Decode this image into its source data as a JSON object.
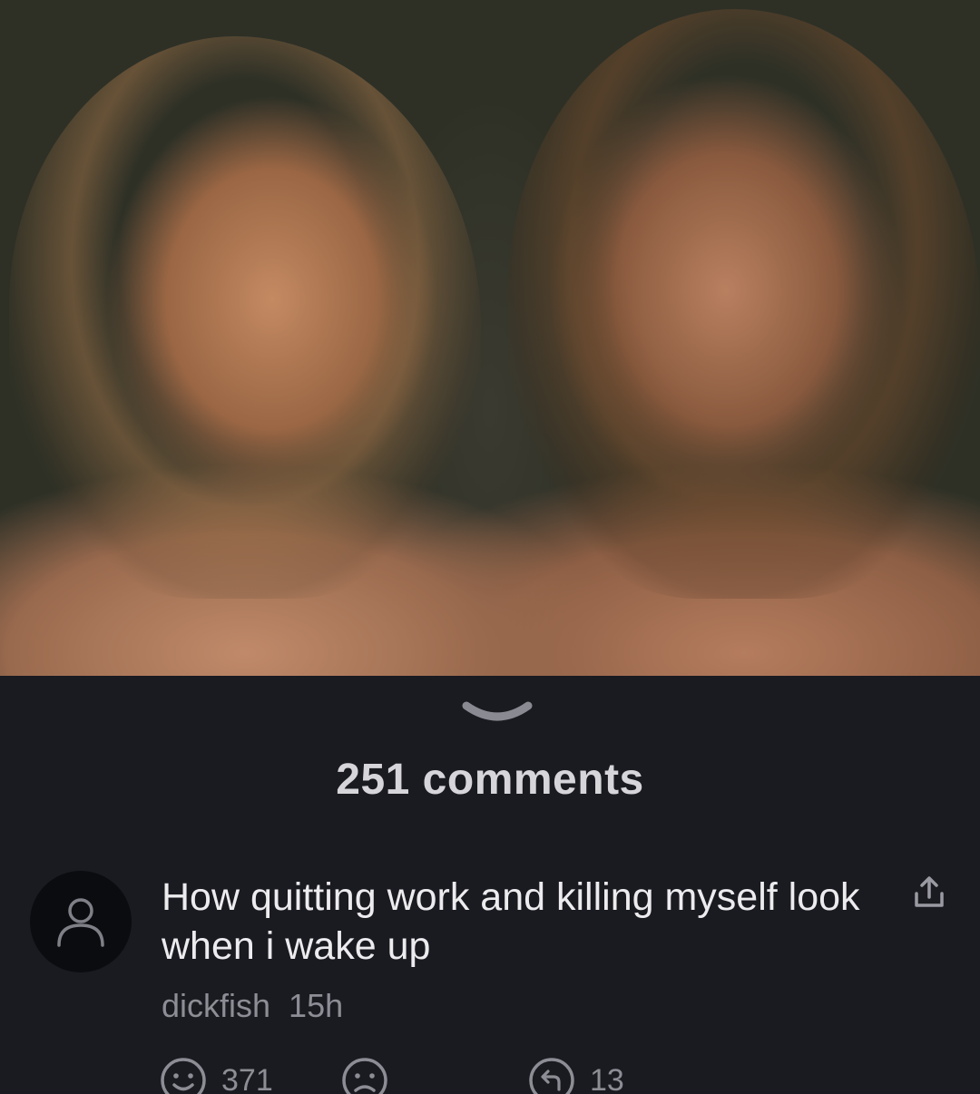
{
  "post": {
    "comments_count_label": "251 comments"
  },
  "comment": {
    "text": "How quitting work and killing myself look when i wake up",
    "author": "dickfish",
    "time": "15h",
    "upvotes": "371",
    "replies": "13"
  },
  "icons": {
    "collapse": "chevron-down-icon",
    "avatar": "user-icon",
    "share": "share-icon",
    "upvote": "smiley-happy-icon",
    "downvote": "smiley-sad-icon",
    "reply": "reply-icon"
  },
  "colors": {
    "background": "#1a1a21",
    "text_primary": "#ececef",
    "text_secondary": "#8d8d95"
  }
}
